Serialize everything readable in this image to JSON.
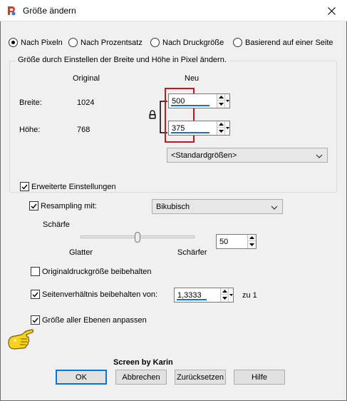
{
  "window": {
    "title": "Größe ändern"
  },
  "mode_radios": [
    {
      "label": "Nach Pixeln",
      "selected": true
    },
    {
      "label": "Nach Prozentsatz",
      "selected": false
    },
    {
      "label": "Nach Druckgröße",
      "selected": false
    },
    {
      "label": "Basierend auf einer Seite",
      "selected": false
    }
  ],
  "pixel_group": {
    "legend": "Größe durch Einstellen der Breite und Höhe in Pixel ändern.",
    "col_original": "Original",
    "col_new": "Neu",
    "width_label": "Breite:",
    "width_original": "1024",
    "width_new": "500",
    "height_label": "Höhe:",
    "height_original": "768",
    "height_new": "375",
    "preset_dropdown": "<Standardgrößen>"
  },
  "advanced": {
    "label": "Erweiterte Einstellungen",
    "checked": true,
    "resampling_label": "Resampling mit:",
    "resampling_checked": true,
    "resampling_value": "Bikubisch",
    "sharpness_label": "Schärfe",
    "sharpness_left": "Glatter",
    "sharpness_right": "Schärfer",
    "sharpness_value": "50",
    "sharpness_fraction": 0.5,
    "keep_print_size_label": "Originaldruckgröße beibehalten",
    "keep_print_size_checked": false,
    "aspect_label": "Seitenverhältnis beibehalten von:",
    "aspect_checked": true,
    "aspect_value": "1,3333",
    "aspect_suffix": "zu 1",
    "all_layers_label": "Größe aller Ebenen anpassen",
    "all_layers_checked": true
  },
  "watermark": "Screen by Karin",
  "buttons": {
    "ok": "OK",
    "cancel": "Abbrechen",
    "reset": "Zurücksetzen",
    "help": "Hilfe"
  },
  "colors": {
    "highlight_box": "#c4161c",
    "accent_underline": "#1c6fc6"
  },
  "icons": {
    "app": "paintshop-icon",
    "close": "close-icon",
    "pointer": "pointing-hand-icon",
    "lock": "lock-icon"
  }
}
